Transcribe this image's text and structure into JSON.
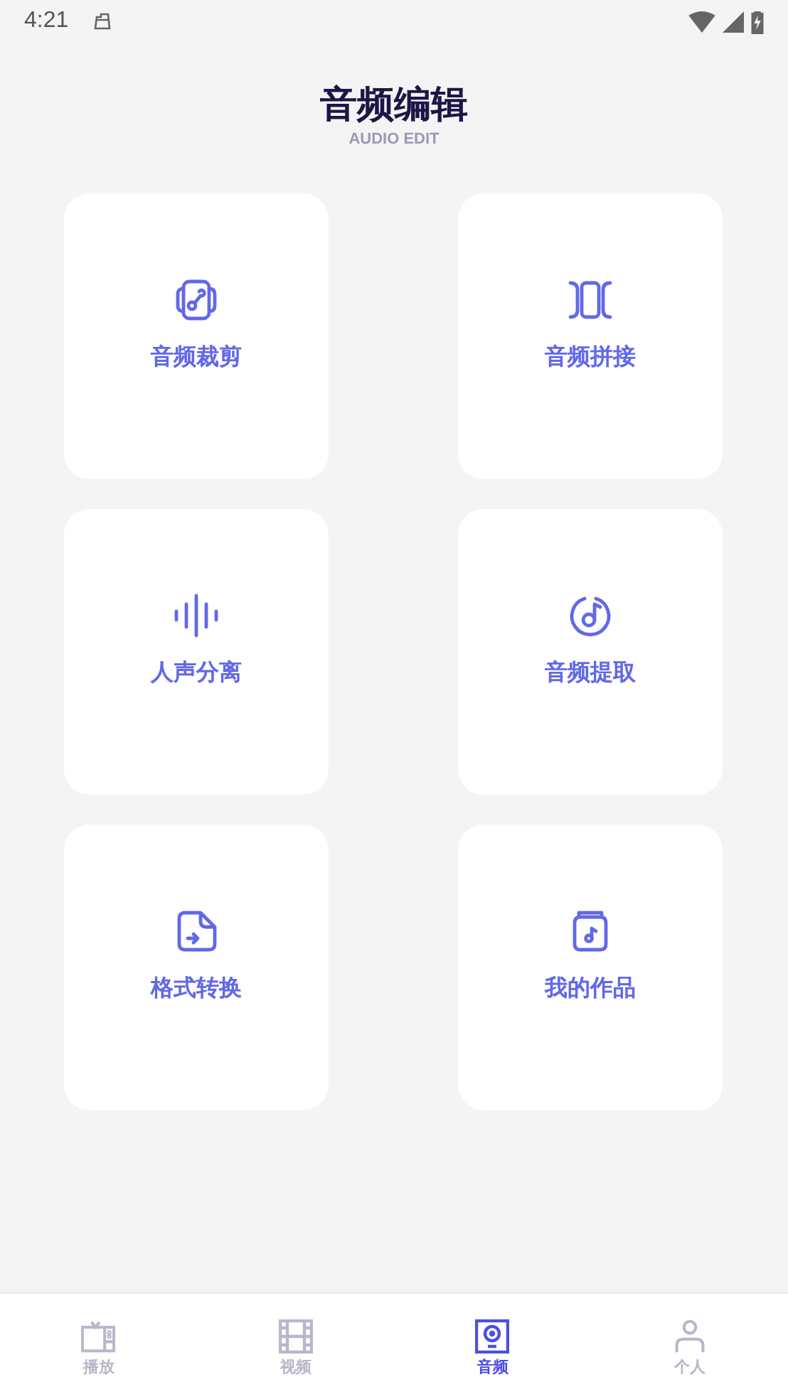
{
  "status_bar": {
    "time": "4:21"
  },
  "header": {
    "title": "音频编辑",
    "subtitle": "AUDIO EDIT"
  },
  "tools": [
    {
      "kind": "trim",
      "label": "音频裁剪"
    },
    {
      "kind": "join",
      "label": "音频拼接"
    },
    {
      "kind": "vocal",
      "label": "人声分离"
    },
    {
      "kind": "extract",
      "label": "音频提取"
    },
    {
      "kind": "convert",
      "label": "格式转换"
    },
    {
      "kind": "works",
      "label": "我的作品"
    }
  ],
  "tabs": [
    {
      "kind": "play",
      "label": "播放",
      "selected": false
    },
    {
      "kind": "video",
      "label": "视频",
      "selected": false
    },
    {
      "kind": "audio",
      "label": "音频",
      "selected": true
    },
    {
      "kind": "me",
      "label": "个人",
      "selected": false
    }
  ]
}
